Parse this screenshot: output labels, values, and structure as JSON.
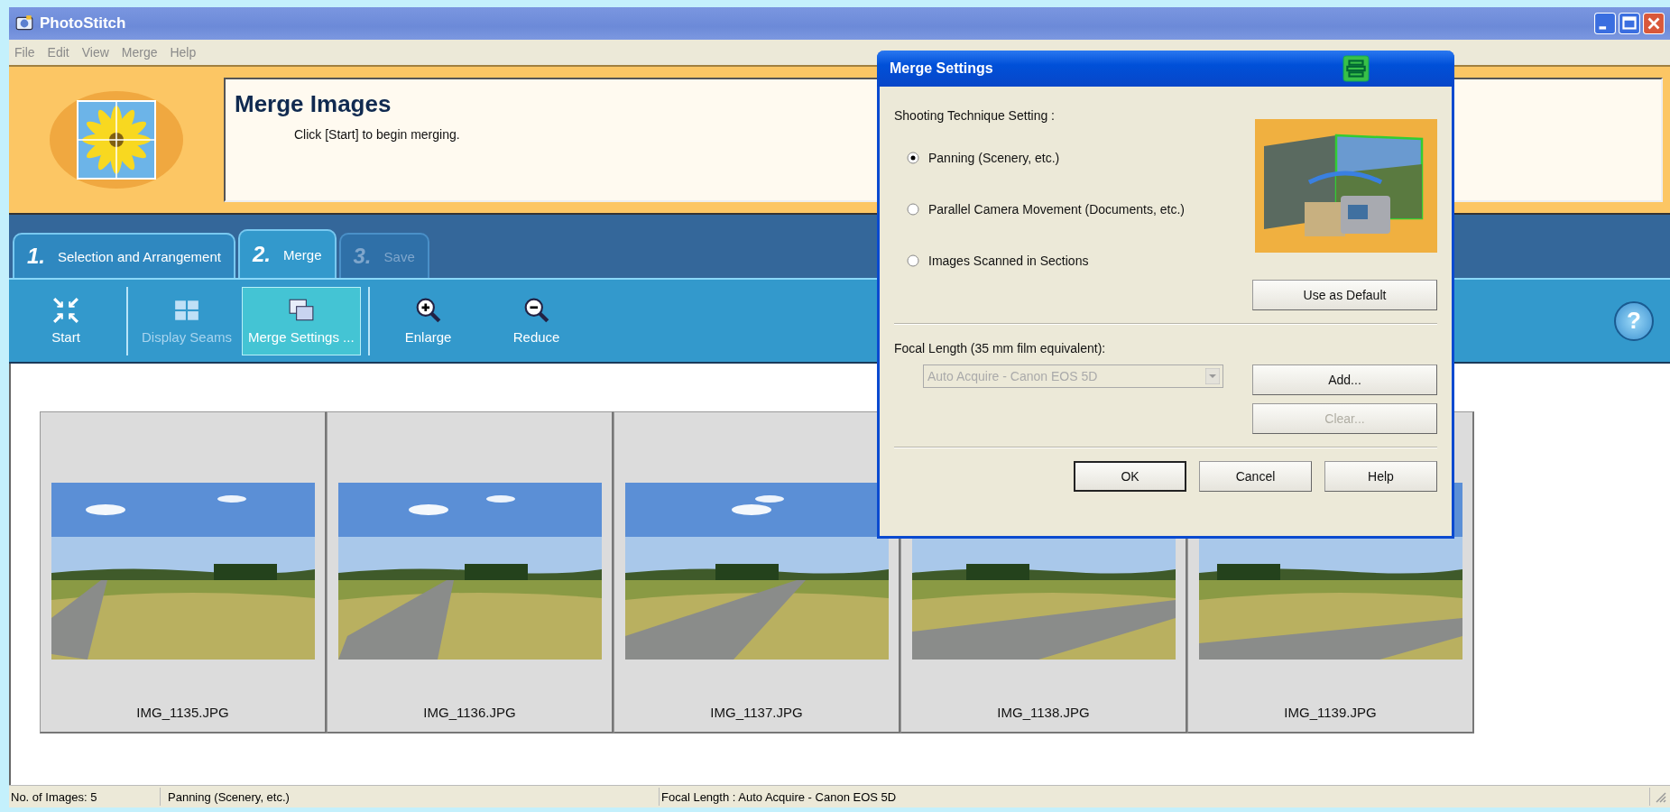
{
  "window": {
    "title": "PhotoStitch"
  },
  "menu": [
    "File",
    "Edit",
    "View",
    "Merge",
    "Help"
  ],
  "header": {
    "title": "Merge Images",
    "instruction": "Click [Start] to begin merging."
  },
  "tabs": [
    {
      "number": "1.",
      "label": "Selection and Arrangement",
      "selected": false,
      "disabled": false
    },
    {
      "number": "2.",
      "label": "Merge",
      "selected": true,
      "disabled": false
    },
    {
      "number": "3.",
      "label": "Save",
      "selected": false,
      "disabled": true
    }
  ],
  "toolbar_groups": [
    [
      {
        "kind": "start",
        "label": "Start",
        "disabled": false,
        "selected": false
      }
    ],
    [
      {
        "kind": "seams",
        "label": "Display Seams",
        "disabled": true,
        "selected": false
      },
      {
        "kind": "settings",
        "label": "Merge Settings ...",
        "disabled": false,
        "selected": true
      }
    ],
    [
      {
        "kind": "enlarge",
        "label": "Enlarge",
        "disabled": false,
        "selected": false
      },
      {
        "kind": "reduce",
        "label": "Reduce",
        "disabled": false,
        "selected": false
      }
    ]
  ],
  "help_button": {
    "label": "?"
  },
  "images": [
    {
      "filename": "IMG_1135.JPG",
      "kind": "picture"
    },
    {
      "filename": "IMG_1136.JPG",
      "kind": "picture"
    },
    {
      "filename": "IMG_1137.JPG",
      "kind": "picture"
    },
    {
      "filename": "IMG_1138.JPG",
      "kind": "picture"
    },
    {
      "filename": "IMG_1139.JPG",
      "kind": "picture"
    }
  ],
  "dialog": {
    "title": "Merge Settings",
    "technique_label": "Shooting Technique Setting :",
    "options": [
      {
        "label": "Panning (Scenery, etc.)",
        "selected": true
      },
      {
        "label": "Parallel Camera Movement (Documents, etc.)",
        "selected": false
      },
      {
        "label": "Images Scanned in Sections",
        "selected": false
      }
    ],
    "default_button": "Use as Default",
    "focal_label": "Focal Length (35 mm film equivalent):",
    "focal_select": {
      "value": "Auto Acquire - Canon EOS 5D",
      "disabled": true
    },
    "add_button": {
      "label": "Add...",
      "disabled": false
    },
    "clear_button": {
      "label": "Clear...",
      "disabled": true
    },
    "buttons": [
      {
        "label": "OK",
        "default": true
      },
      {
        "label": "Cancel",
        "default": false
      },
      {
        "label": "Help",
        "default": false
      }
    ]
  },
  "status_bar": [
    "No. of Images: 5",
    "Panning (Scenery, etc.)",
    "Focal Length : Auto Acquire - Canon EOS 5D"
  ]
}
